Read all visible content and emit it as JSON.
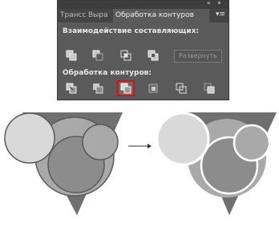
{
  "panel": {
    "top_controls": {
      "collapse": "«",
      "close": "×"
    },
    "tabs": [
      {
        "label": "Трансс"
      },
      {
        "label": "Выра"
      },
      {
        "label": "Обработка контуров"
      }
    ],
    "menu_icon": "menu-icon",
    "shape_modes_label": "Взаимодействие составляющих:",
    "expand_label": "Развернуть",
    "pathfinders_label": "Обработка контуров:"
  },
  "illustration": {
    "arrow": "→",
    "colors": {
      "light": "#d9d9d9",
      "medium": "#a9a9a9",
      "dark": "#707070",
      "darker": "#5a5a5a",
      "selected_border": "#d0141e"
    }
  }
}
